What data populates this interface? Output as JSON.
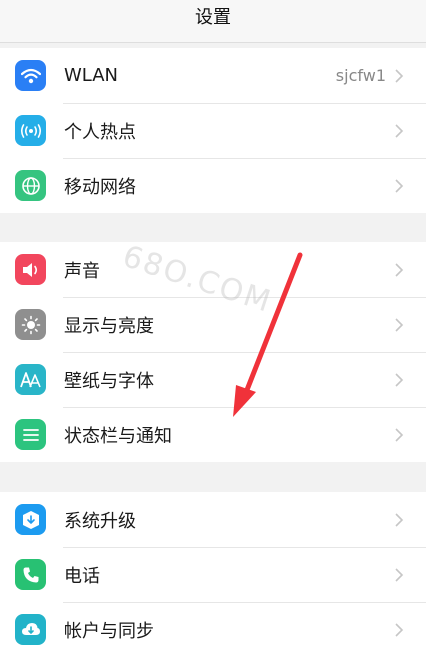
{
  "header": {
    "title": "设置"
  },
  "groups": [
    {
      "items": [
        {
          "label": "WLAN",
          "value": "sjcfw1",
          "icon": "wifi-icon",
          "color": "#2a7ff5"
        },
        {
          "label": "个人热点",
          "icon": "hotspot-icon",
          "color": "#25aee8"
        },
        {
          "label": "移动网络",
          "icon": "globe-icon",
          "color": "#35c480"
        }
      ]
    },
    {
      "items": [
        {
          "label": "声音",
          "icon": "speaker-icon",
          "color": "#f2465d"
        },
        {
          "label": "显示与亮度",
          "icon": "brightness-icon",
          "color": "#8f8f8f"
        },
        {
          "label": "壁纸与字体",
          "icon": "font-icon",
          "color": "#29b5c8"
        },
        {
          "label": "状态栏与通知",
          "icon": "notification-list-icon",
          "color": "#2cc47f"
        }
      ]
    },
    {
      "items": [
        {
          "label": "系统升级",
          "icon": "system-update-icon",
          "color": "#1c9bf0"
        },
        {
          "label": "电话",
          "icon": "phone-icon",
          "color": "#28c173"
        },
        {
          "label": "帐户与同步",
          "icon": "account-sync-icon",
          "color": "#22b3c9"
        }
      ]
    }
  ],
  "watermark": "68O.COM",
  "annotation": {
    "arrow_color": "#f0323a"
  }
}
